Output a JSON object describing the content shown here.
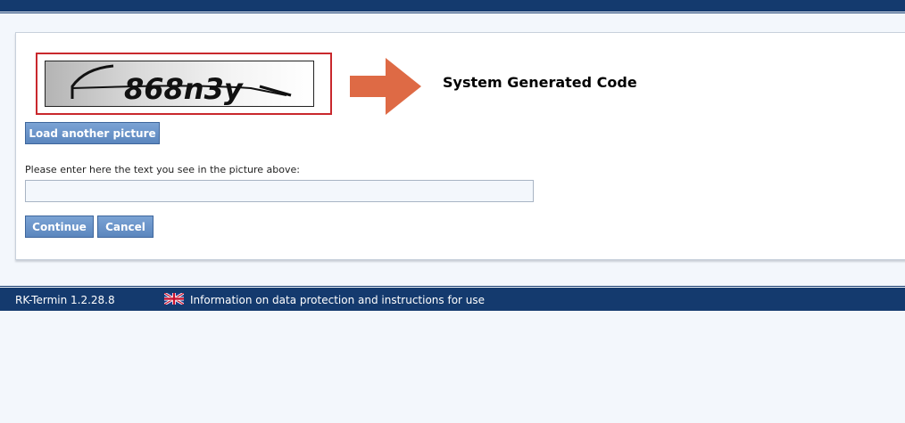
{
  "captcha": {
    "code_text": "868n3y",
    "annotation_label": "System Generated Code"
  },
  "buttons": {
    "load_another": "Load another picture",
    "continue": "Continue",
    "cancel": "Cancel"
  },
  "form": {
    "prompt": "Please enter here the text you see in the picture above:",
    "input_value": ""
  },
  "footer": {
    "version": "RK-Termin 1.2.28.8",
    "language_icon": "uk-flag-icon",
    "info_link": "Information on data protection and instructions for use"
  },
  "colors": {
    "brand_navy": "#143a6e",
    "button_blue": "#6791c8",
    "highlight_red": "#c9282d",
    "arrow_orange": "#de6a45",
    "page_bg": "#f3f7fc"
  }
}
